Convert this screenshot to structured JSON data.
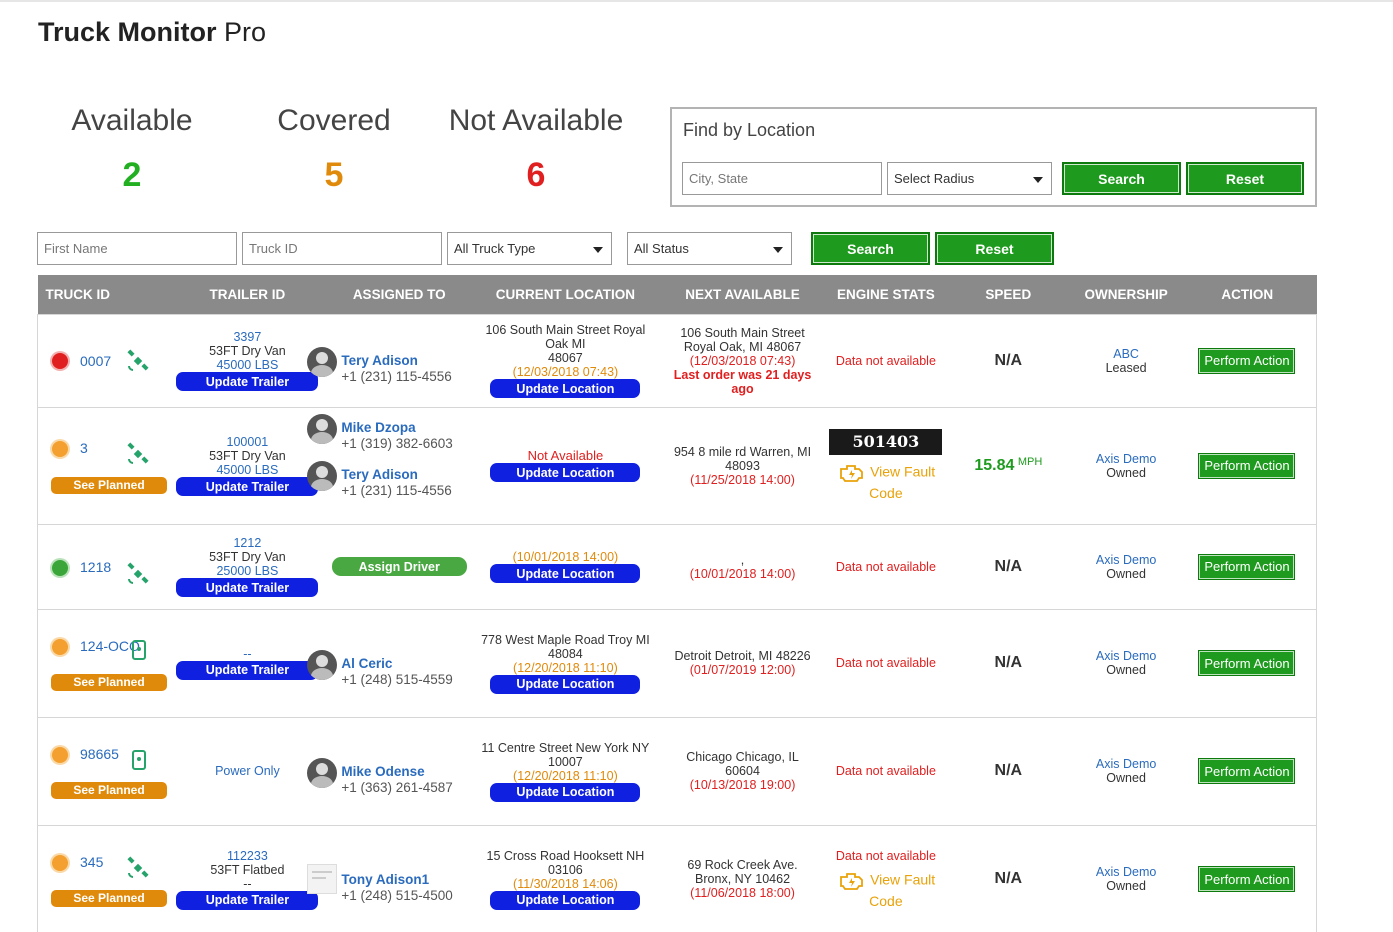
{
  "app": {
    "title_bold": "Truck Monitor",
    "title_light": "Pro"
  },
  "stats": [
    {
      "label": "Available",
      "value": "2",
      "color": "#22b022"
    },
    {
      "label": "Covered",
      "value": "5",
      "color": "#e08a0b"
    },
    {
      "label": "Not Available",
      "value": "6",
      "color": "#e02020"
    }
  ],
  "find": {
    "title": "Find by Location",
    "location_placeholder": "City, State",
    "radius_label": "Select Radius",
    "search_label": "Search",
    "reset_label": "Reset"
  },
  "filters": {
    "first_name_placeholder": "First Name",
    "truck_id_placeholder": "Truck ID",
    "truck_type_label": "All Truck Type",
    "status_label": "All Status",
    "search_label": "Search",
    "reset_label": "Reset"
  },
  "table": {
    "columns": [
      "TRUCK ID",
      "TRAILER ID",
      "ASSIGNED TO",
      "CURRENT LOCATION",
      "NEXT AVAILABLE",
      "ENGINE STATS",
      "SPEED",
      "OWNERSHIP",
      "ACTION"
    ],
    "see_planned_label": "See Planned",
    "update_trailer_label": "Update Trailer",
    "update_location_label": "Update Location",
    "assign_driver_label": "Assign Driver",
    "perform_action_label": "Perform Action",
    "data_not_available": "Data not available",
    "na_label": "N/A",
    "view_fault_line1": "View Fault",
    "view_fault_line2": "Code",
    "rows": [
      {
        "truck_id": "0007",
        "trailer_id": "3397",
        "trailer_type": "53FT Dry Van",
        "trailer_weight": "45000 LBS",
        "driver1_name": "Tery Adison",
        "driver1_phone": "+1 (231) 115-4556",
        "loc_line1": "106 South Main Street Royal Oak MI",
        "loc_line2": "48067",
        "loc_time": "(12/03/2018 07:43)",
        "next_line1": "106 South Main Street",
        "next_line2": "Royal Oak, MI 48067",
        "next_time": "(12/03/2018 07:43)",
        "next_note1": "Last order was 21 days",
        "next_note2": "ago",
        "own_company": "ABC",
        "own_type": "Leased"
      },
      {
        "truck_id": "3",
        "trailer_id": "100001",
        "trailer_type": "53FT Dry Van",
        "trailer_weight": "45000 LBS",
        "driver1_name": "Mike Dzopa",
        "driver1_phone": "+1 (319) 382-6603",
        "driver2_name": "Tery Adison",
        "driver2_phone": "+1 (231) 115-4556",
        "loc_status": "Not Available",
        "next_line1": "954 8 mile rd Warren, MI",
        "next_line2": "48093",
        "next_time": "(11/25/2018 14:00)",
        "odometer": "501403",
        "speed": "15.84",
        "speed_unit": "MPH",
        "own_company": "Axis Demo",
        "own_type": "Owned"
      },
      {
        "truck_id": "1218",
        "trailer_id": "1212",
        "trailer_type": "53FT Dry Van",
        "trailer_weight": "25000 LBS",
        "loc_time": "(10/01/2018 14:00)",
        "next_line1": ",",
        "next_time": "(10/01/2018 14:00)",
        "own_company": "Axis Demo",
        "own_type": "Owned"
      },
      {
        "truck_id": "124-OCO",
        "trailer_id": "--",
        "driver1_name": "Al Ceric",
        "driver1_phone": "+1 (248) 515-4559",
        "loc_line1": "778 West Maple Road Troy MI",
        "loc_line2": "48084",
        "loc_time": "(12/20/2018 11:10)",
        "next_line1": "Detroit Detroit, MI 48226",
        "next_time": "(01/07/2019 12:00)",
        "own_company": "Axis Demo",
        "own_type": "Owned"
      },
      {
        "truck_id": "98665",
        "trailer_text": "Power Only",
        "driver1_name": "Mike Odense",
        "driver1_phone": "+1 (363) 261-4587",
        "loc_line1": "11 Centre Street New York NY",
        "loc_line2": "10007",
        "loc_time": "(12/20/2018 11:10)",
        "next_line1": "Chicago Chicago, IL",
        "next_line2": "60604",
        "next_time": "(10/13/2018 19:00)",
        "own_company": "Axis Demo",
        "own_type": "Owned"
      },
      {
        "truck_id": "345",
        "trailer_id": "112233",
        "trailer_type": "53FT Flatbed",
        "trailer_weight": "--",
        "driver1_name": "Tony Adison1",
        "driver1_phone": "+1 (248) 515-4500",
        "loc_line1": "15 Cross Road Hooksett NH 03106",
        "loc_time": "(11/30/2018 14:06)",
        "next_line1": "69 Rock Creek Ave.",
        "next_line2": "Bronx, NY 10462",
        "next_time": "(11/06/2018 18:00)",
        "own_company": "Axis Demo",
        "own_type": "Owned"
      }
    ]
  }
}
